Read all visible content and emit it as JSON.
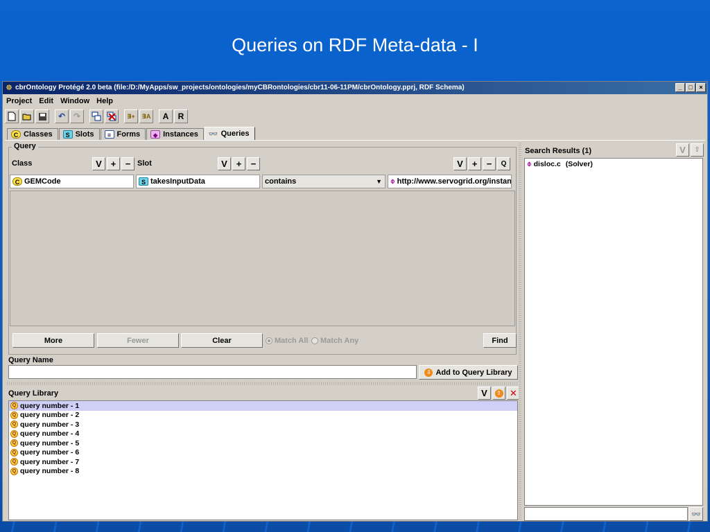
{
  "slide": {
    "title": "Queries on RDF Meta-data - I"
  },
  "window": {
    "app_name": "cbrOntology",
    "title": "cbrOntology  Protégé 2.0 beta   (file:/D:/MyApps/sw_projects/ontologies/myCBRontologies/cbr11-06-11PM/cbrOntology.pprj, RDF Schema)",
    "controls": [
      "_",
      "□",
      "×"
    ]
  },
  "menu": [
    "Project",
    "Edit",
    "Window",
    "Help"
  ],
  "toolbar": {
    "icons": [
      "new-file-icon",
      "open-folder-icon",
      "save-icon",
      "undo-icon",
      "redo-icon",
      "cascade-icon",
      "close-all-icon",
      "insert-icon",
      "insert-alt-icon"
    ],
    "text_buttons": [
      "A",
      "R"
    ]
  },
  "tabs": [
    {
      "label": "Classes",
      "icon": "C",
      "active": false
    },
    {
      "label": "Slots",
      "icon": "S",
      "active": false
    },
    {
      "label": "Forms",
      "icon": "F",
      "active": false
    },
    {
      "label": "Instances",
      "icon": "I",
      "active": false
    },
    {
      "label": "Queries",
      "icon": "binoculars",
      "active": true
    }
  ],
  "query": {
    "group_label": "Query",
    "class_label": "Class",
    "slot_label": "Slot",
    "square_buttons": [
      "V",
      "+",
      "−",
      "Q"
    ],
    "class_value": "GEMCode",
    "slot_value": "takesInputData",
    "operator_value": "contains",
    "value_value": "http://www.servogrid.org/instan...",
    "buttons": {
      "more": "More",
      "fewer": "Fewer",
      "clear": "Clear",
      "find": "Find"
    },
    "match_all": "Match All",
    "match_any": "Match Any"
  },
  "query_name": {
    "label": "Query Name",
    "value": "",
    "add_button": "Add to Query Library"
  },
  "query_library": {
    "label": "Query Library",
    "items": [
      "query number - 1",
      "query number - 2",
      "query number - 3",
      "query number - 4",
      "query number - 5",
      "query number - 6",
      "query number - 7",
      "query number - 8"
    ],
    "selected_index": 0
  },
  "search_results": {
    "label": "Search Results (1)",
    "items": [
      {
        "name": "disloc.c",
        "type": "(Solver)"
      }
    ],
    "search_value": ""
  },
  "colors": {
    "slide_bg": "#0b5cc2",
    "titlebar_start": "#0a246a",
    "titlebar_end": "#3a6ea5",
    "panel": "#d4d0c8",
    "selection": "#cfcff8"
  }
}
